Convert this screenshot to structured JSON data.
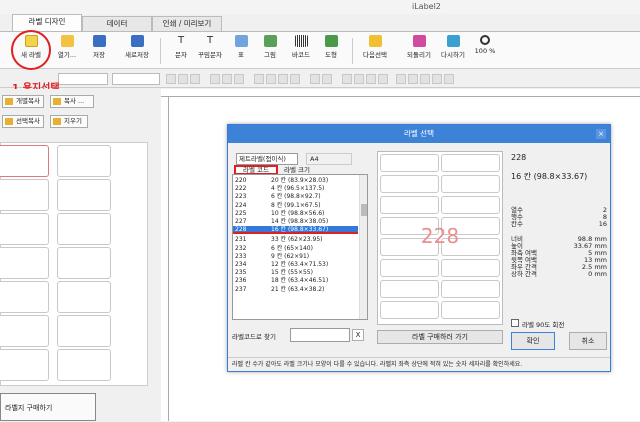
{
  "window": {
    "title": "iLabel2"
  },
  "tabs": [
    {
      "label": "라벨 디자인"
    },
    {
      "label": "데이터"
    },
    {
      "label": "인쇄 / 미리보기"
    }
  ],
  "ribbon": {
    "new_label": "새 라벨",
    "open": "열기...",
    "save": "저장",
    "save_as": "새로저장",
    "text": "문자",
    "curved_text": "꾸밈문자",
    "table": "표",
    "image": "그림",
    "barcode": "바코드",
    "shape": "도형",
    "next_select": "다음선택",
    "undo": "되돌리기",
    "redo": "다시하기",
    "zoom": "100 %"
  },
  "annotation": "1.용지선택",
  "left_panel": {
    "copy_each": "개별복사",
    "copy": "복사 ...",
    "copy_selected": "선택복사",
    "erase": "지우기",
    "buy_label": "라벨지 구매하기"
  },
  "dialog": {
    "title": "라벨 선택",
    "close": "×",
    "category": "제트라벨(접이식)",
    "paper": "A4",
    "tab_code": "라벨 코드",
    "tab_size": "라벨 크기",
    "rows": [
      {
        "code": "220",
        "desc": "20 칸 (83.9×28.03)"
      },
      {
        "code": "222",
        "desc": "4 칸 (96.5×137.5)"
      },
      {
        "code": "223",
        "desc": "6 칸 (98.8×92.7)"
      },
      {
        "code": "224",
        "desc": "8 칸 (99.1×67.5)"
      },
      {
        "code": "225",
        "desc": "10 칸 (98.8×56.6)"
      },
      {
        "code": "227",
        "desc": "14 칸 (98.8×38.05)"
      },
      {
        "code": "228",
        "desc": "16 칸 (98.8×33.67)"
      },
      {
        "code": "231",
        "desc": "33 칸 (62×23.95)"
      },
      {
        "code": "232",
        "desc": "6 칸 (65×140)"
      },
      {
        "code": "233",
        "desc": "9 칸 (62×91)"
      },
      {
        "code": "234",
        "desc": "12 칸 (63.4×71.53)"
      },
      {
        "code": "235",
        "desc": "15 칸 (55×55)"
      },
      {
        "code": "236",
        "desc": "18 칸 (63.4×46.51)"
      },
      {
        "code": "237",
        "desc": "21 칸 (63.4×38.2)"
      }
    ],
    "search_label": "라벨코드로 찾기",
    "search_value": "",
    "search_clear": "X",
    "preview_code": "228",
    "buy_button": "라벨 구매하러 가기",
    "info_code": "228",
    "info_summary": "16 칸 (98.8×33.67)",
    "specs": [
      {
        "label": "열수",
        "value": "2"
      },
      {
        "label": "행수",
        "value": "8"
      },
      {
        "label": "칸수",
        "value": "16"
      },
      {
        "label": "너비",
        "value": "98.8 mm"
      },
      {
        "label": "높이",
        "value": "33.67 mm"
      },
      {
        "label": "좌측 여백",
        "value": "5 mm"
      },
      {
        "label": "윗쪽 여백",
        "value": "13 mm"
      },
      {
        "label": "좌우 간격",
        "value": "2.5 mm"
      },
      {
        "label": "상하 간격",
        "value": "0 mm"
      }
    ],
    "rotate": "라벨 90도 회전",
    "ok": "확인",
    "cancel": "취소",
    "footer": "라벨 칸 수가 같아도 라벨 크기나 모양이 다를 수 있습니다.  라벨지 좌측 상단에 적혀 있는 숫자 세자리를 확인하세요."
  },
  "colors": {
    "accent": "#3c83d8",
    "annotation": "#e02020",
    "selected_row": "#3478d8",
    "preview_code": "#e89090"
  }
}
